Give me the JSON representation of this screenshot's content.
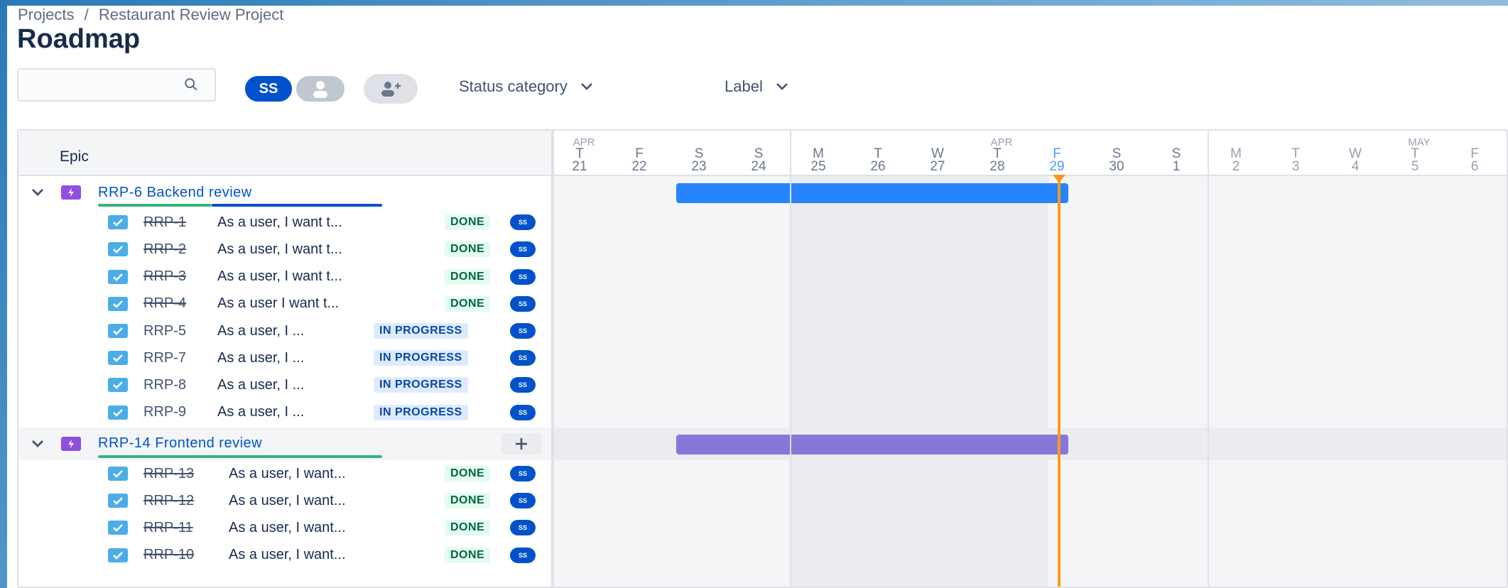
{
  "breadcrumb": {
    "projects": "Projects",
    "separator": "/",
    "project": "Restaurant Review Project"
  },
  "page_title": "Roadmap",
  "search": {
    "placeholder": "",
    "icon": "search-icon"
  },
  "people": {
    "current_user_initials": "SS"
  },
  "filters": {
    "status_category": "Status category",
    "label": "Label"
  },
  "roadmap": {
    "epic_column_title": "Epic",
    "timeline": {
      "months": [
        {
          "label": "APR"
        },
        {
          "label": "APR"
        },
        {
          "label": "MAY"
        }
      ],
      "days": [
        {
          "dow": "T",
          "num": "21"
        },
        {
          "dow": "F",
          "num": "22"
        },
        {
          "dow": "S",
          "num": "23"
        },
        {
          "dow": "S",
          "num": "24"
        },
        {
          "dow": "M",
          "num": "25"
        },
        {
          "dow": "T",
          "num": "26"
        },
        {
          "dow": "W",
          "num": "27"
        },
        {
          "dow": "T",
          "num": "28"
        },
        {
          "dow": "F",
          "num": "29"
        },
        {
          "dow": "S",
          "num": "30"
        },
        {
          "dow": "S",
          "num": "1"
        },
        {
          "dow": "M",
          "num": "2"
        },
        {
          "dow": "T",
          "num": "3"
        },
        {
          "dow": "W",
          "num": "4"
        },
        {
          "dow": "T",
          "num": "5"
        },
        {
          "dow": "F",
          "num": "6"
        }
      ],
      "today": "29"
    },
    "epics": [
      {
        "key": "RRP-6",
        "name": "Backend review",
        "color": "#2684ff",
        "start_day": "23",
        "end_day": "29",
        "progress": {
          "done_fraction": 0.4,
          "in_progress_fraction": 0.6
        },
        "children": [
          {
            "key": "RRP-1",
            "summary": "As a user, I want t...",
            "status": "DONE",
            "assignee": "SS"
          },
          {
            "key": "RRP-2",
            "summary": "As a user, I want t...",
            "status": "DONE",
            "assignee": "SS"
          },
          {
            "key": "RRP-3",
            "summary": "As a user, I want t...",
            "status": "DONE",
            "assignee": "SS"
          },
          {
            "key": "RRP-4",
            "summary": "As a user I want t...",
            "status": "DONE",
            "assignee": "SS"
          },
          {
            "key": "RRP-5",
            "summary": "As a user, I ...",
            "status": "IN PROGRESS",
            "assignee": "SS"
          },
          {
            "key": "RRP-7",
            "summary": "As a user, I ...",
            "status": "IN PROGRESS",
            "assignee": "SS"
          },
          {
            "key": "RRP-8",
            "summary": "As a user, I ...",
            "status": "IN PROGRESS",
            "assignee": "SS"
          },
          {
            "key": "RRP-9",
            "summary": "As a user, I ...",
            "status": "IN PROGRESS",
            "assignee": "SS"
          }
        ]
      },
      {
        "key": "RRP-14",
        "name": "Frontend review",
        "color": "#8777d9",
        "start_day": "23",
        "end_day": "29",
        "progress": {
          "done_fraction": 1.0,
          "in_progress_fraction": 0.0
        },
        "add_child_label": "+",
        "children": [
          {
            "key": "RRP-13",
            "summary": "As a user, I want...",
            "status": "DONE",
            "assignee": "SS"
          },
          {
            "key": "RRP-12",
            "summary": "As a user, I want...",
            "status": "DONE",
            "assignee": "SS"
          },
          {
            "key": "RRP-11",
            "summary": "As a user, I want...",
            "status": "DONE",
            "assignee": "SS"
          },
          {
            "key": "RRP-10",
            "summary": "As a user, I want...",
            "status": "DONE",
            "assignee": "SS"
          }
        ]
      }
    ]
  },
  "colors": {
    "brand_blue": "#0052cc",
    "today_line": "#ff991f",
    "done_green": "#36b37e",
    "epic_purple": "#904ee2",
    "task_blue": "#4bade8"
  }
}
